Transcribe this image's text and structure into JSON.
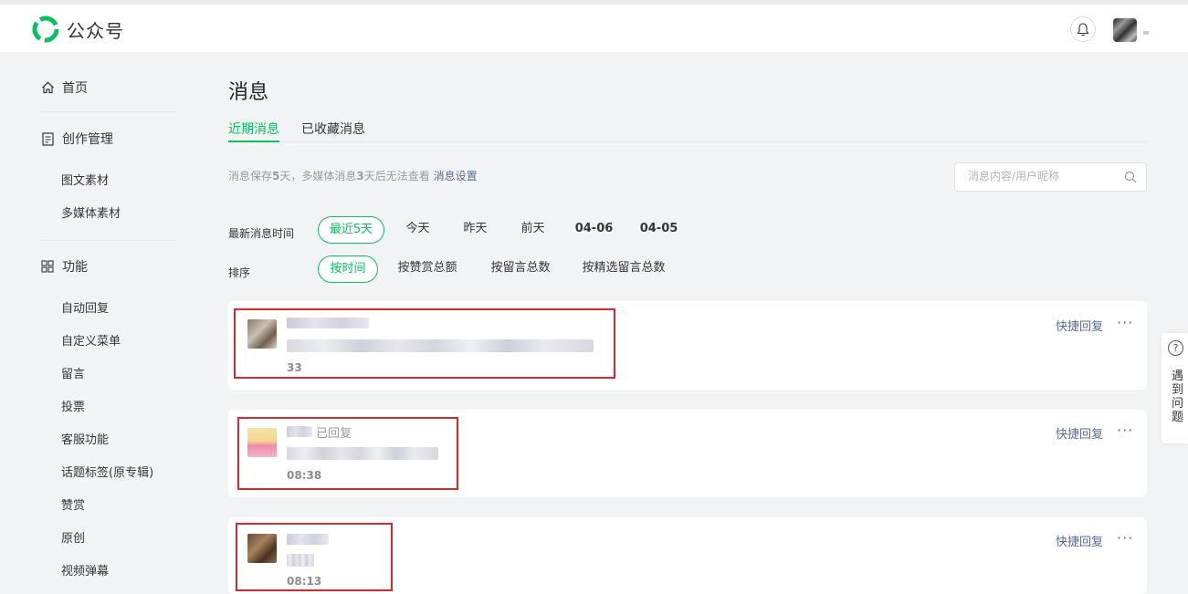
{
  "header": {
    "app_name": "公众号",
    "brand_color": "#07c160"
  },
  "sidebar": {
    "home": "首页",
    "create_section": "创作管理",
    "create_items": [
      "图文素材",
      "多媒体素材"
    ],
    "function_section": "功能",
    "function_items": [
      "自动回复",
      "自定义菜单",
      "留言",
      "投票",
      "客服功能",
      "话题标签(原专辑)",
      "赞赏",
      "原创",
      "视频弹幕"
    ]
  },
  "page": {
    "title": "消息",
    "tabs": [
      {
        "label": "近期消息",
        "active": true
      },
      {
        "label": "已收藏消息",
        "active": false
      }
    ],
    "hint_prefix": "消息保存",
    "hint_days": "5",
    "hint_mid": "天，多媒体消息",
    "hint_days2": "3",
    "hint_suffix": "天后无法查看 ",
    "hint_link": "消息设置",
    "search_placeholder": "消息内容/用户昵称"
  },
  "filters": {
    "time_label": "最新消息时间",
    "time_options": [
      "最近5天",
      "今天",
      "昨天",
      "前天",
      "04-06",
      "04-05"
    ],
    "time_selected": "最近5天",
    "sort_label": "排序",
    "sort_options": [
      "按时间",
      "按赞赏总额",
      "按留言总数",
      "按精选留言总数"
    ],
    "sort_selected": "按时间"
  },
  "messages": [
    {
      "time": "33",
      "replied": "",
      "quick_reply": "快捷回复",
      "more": "···"
    },
    {
      "time": "08:38",
      "replied": "已回复",
      "quick_reply": "快捷回复",
      "more": "···"
    },
    {
      "time": "08:13",
      "replied": "",
      "quick_reply": "快捷回复",
      "more": "···"
    }
  ],
  "helper": {
    "icon": "?",
    "text": "遇到问题"
  }
}
